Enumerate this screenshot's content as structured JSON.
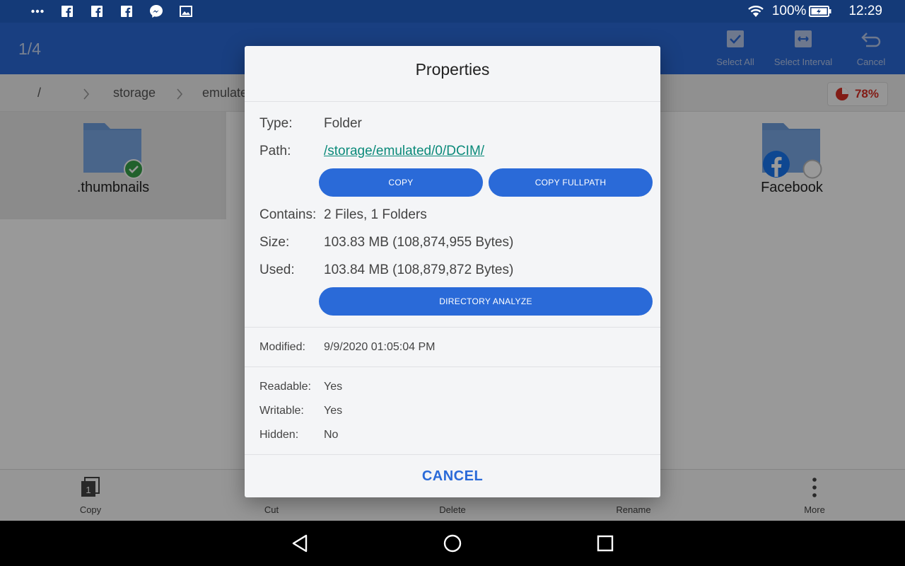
{
  "status_bar": {
    "battery_text": "100%",
    "time": "12:29",
    "icons": [
      "more-dots-icon",
      "facebook-icon",
      "facebook-icon",
      "facebook-icon",
      "messenger-icon",
      "gallery-icon",
      "wifi-icon",
      "battery-icon"
    ]
  },
  "app_bar": {
    "counter": "1/4",
    "actions": [
      {
        "label": "Select All",
        "icon": "select-all-icon"
      },
      {
        "label": "Select Interval",
        "icon": "select-interval-icon"
      },
      {
        "label": "Cancel",
        "icon": "undo-icon"
      }
    ]
  },
  "breadcrumb": {
    "items": [
      "/",
      "storage",
      "emulated"
    ],
    "usage": "78%"
  },
  "files": [
    {
      "name": ".thumbnails",
      "selected": true
    },
    {
      "name": "Facebook",
      "selected": false
    }
  ],
  "toolbar": {
    "copy": "Copy",
    "copy_badge": "1",
    "cut": "Cut",
    "delete": "Delete",
    "rename": "Rename",
    "more": "More"
  },
  "dialog": {
    "title": "Properties",
    "type_label": "Type:",
    "type_value": "Folder",
    "path_label": "Path:",
    "path_value": "/storage/emulated/0/DCIM/",
    "copy_btn": "COPY",
    "copy_fullpath_btn": "COPY FULLPATH",
    "contains_label": "Contains:",
    "contains_value": "2 Files, 1 Folders",
    "size_label": "Size:",
    "size_value": "103.83 MB (108,874,955 Bytes)",
    "used_label": "Used:",
    "used_value": "103.84 MB (108,879,872 Bytes)",
    "analyze_btn": "DIRECTORY ANALYZE",
    "modified_label": "Modified:",
    "modified_value": "9/9/2020 01:05:04 PM",
    "readable_label": "Readable:",
    "readable_value": "Yes",
    "writable_label": "Writable:",
    "writable_value": "Yes",
    "hidden_label": "Hidden:",
    "hidden_value": "No",
    "cancel_btn": "CANCEL"
  },
  "colors": {
    "status_bar": "#143a78",
    "app_bar": "#2a6ad8",
    "button": "#2a6ad8",
    "link": "#0b8a7a",
    "usage": "#d93025"
  }
}
